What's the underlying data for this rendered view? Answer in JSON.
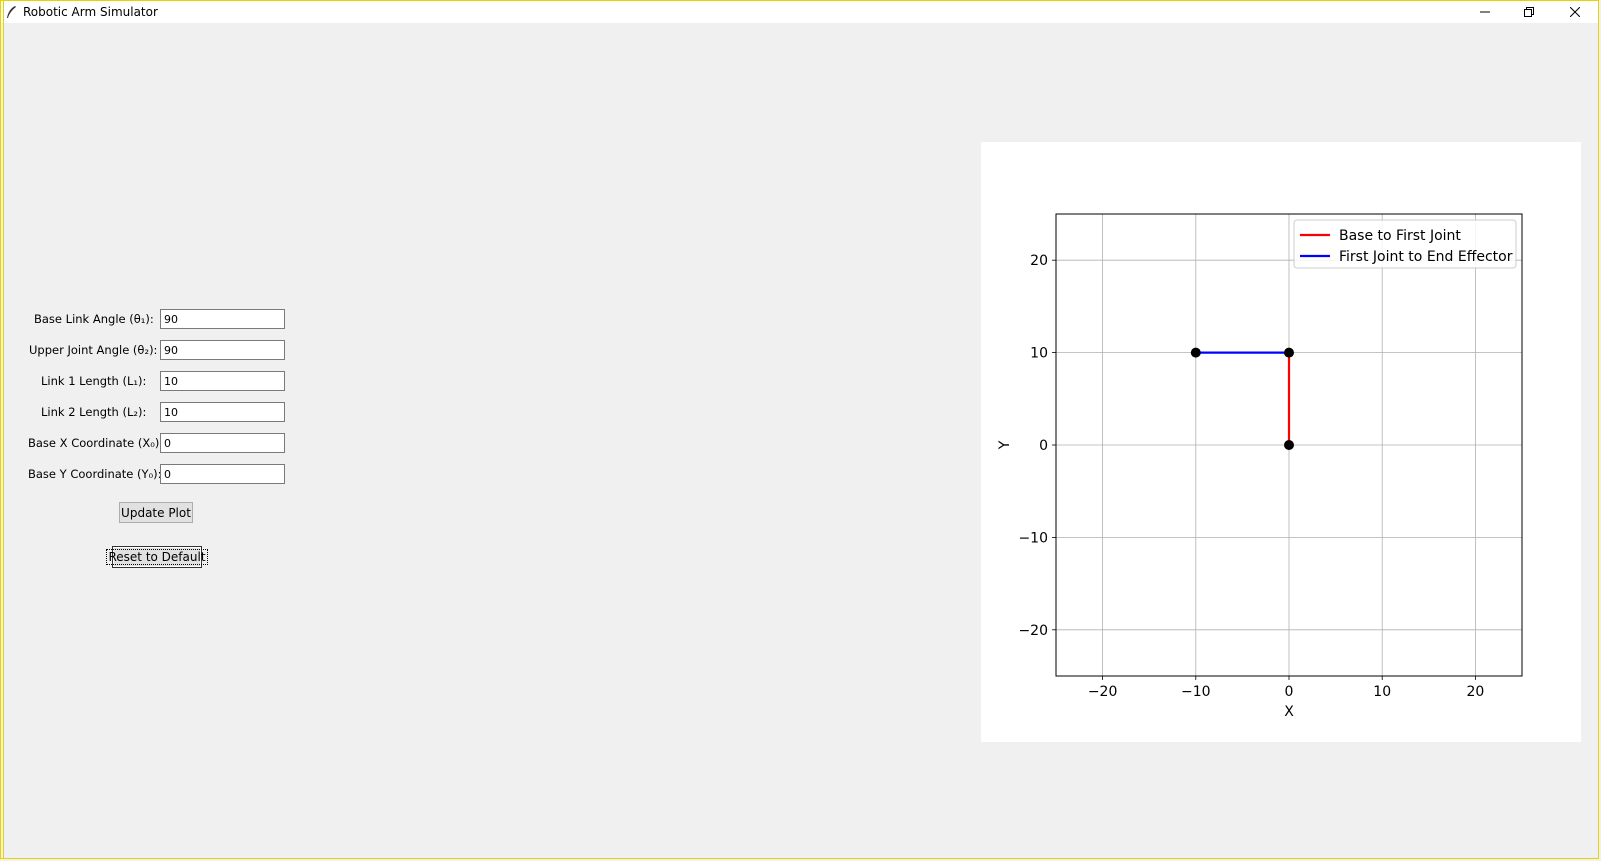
{
  "window": {
    "title": "Robotic Arm Simulator"
  },
  "form": {
    "fields": [
      {
        "label": "Base Link Angle (θ₁):",
        "value": "90"
      },
      {
        "label": "Upper Joint Angle (θ₂):",
        "value": "90"
      },
      {
        "label": "Link 1 Length (L₁):",
        "value": "10"
      },
      {
        "label": "Link 2 Length (L₂):",
        "value": "10"
      },
      {
        "label": "Base X Coordinate (X₀):",
        "value": "0"
      },
      {
        "label": "Base Y Coordinate (Y₀):",
        "value": "0"
      }
    ],
    "update_label": "Update Plot",
    "reset_label": "Reset to Default"
  },
  "chart_data": {
    "type": "line",
    "title": "",
    "xlabel": "X",
    "ylabel": "Y",
    "xlim": [
      -25,
      25
    ],
    "ylim": [
      -25,
      25
    ],
    "xticks": [
      -20,
      -10,
      0,
      10,
      20
    ],
    "yticks": [
      -20,
      -10,
      0,
      10,
      20
    ],
    "grid": true,
    "legend_position": "top-right",
    "series": [
      {
        "name": "Base to First Joint",
        "color": "#ff0000",
        "points": [
          [
            0,
            0
          ],
          [
            0,
            10
          ]
        ]
      },
      {
        "name": "First Joint to End Effector",
        "color": "#0000ff",
        "points": [
          [
            0,
            10
          ],
          [
            -10,
            10
          ]
        ]
      }
    ],
    "joints": [
      [
        0,
        0
      ],
      [
        0,
        10
      ],
      [
        -10,
        10
      ]
    ]
  }
}
